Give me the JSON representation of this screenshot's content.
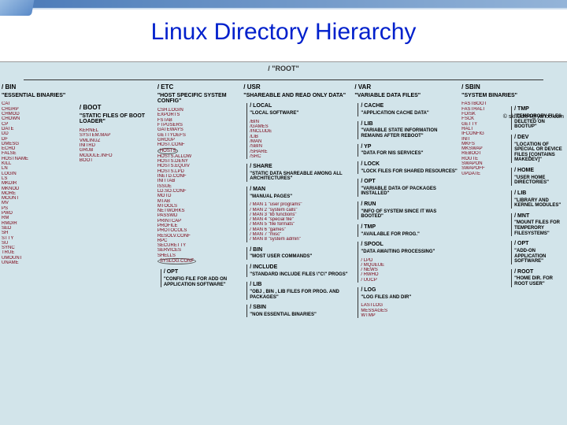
{
  "title": "Linux Directory Hierarchy",
  "attribution": "© skill2die4@yahoo.com",
  "root": "/  \"ROOT\"",
  "bin": {
    "name": "/ BIN",
    "desc": "\"ESSENTIAL BINARIES\"",
    "items": [
      "CAT",
      "CHGRP",
      "CHMOD",
      "CHOWN",
      "CP",
      "DATE",
      "DD",
      "DF",
      "DMESG",
      "ECHO",
      "FALSE",
      "HOSTNAME",
      "KILL",
      "LN",
      "LOGIN",
      "LS",
      "MKDIR",
      "MKNOD",
      "MORE",
      "MOUNT",
      "MV",
      "PS",
      "PWD",
      "RM",
      "RMDIR",
      "SED",
      "SH",
      "STTY",
      "SU",
      "SYNC",
      "TRUE",
      "UMOUNT",
      "UNAME"
    ]
  },
  "boot": {
    "name": "/ BOOT",
    "desc": "\"STATIC FILES OF BOOT LOADER\"",
    "items": [
      "KERNEL",
      "SYSTEM.MAP",
      "VMLINUZ",
      "INITRD",
      "GRUB",
      "MODULE.INFO",
      "BOOT"
    ]
  },
  "etc": {
    "name": "/ ETC",
    "desc": "\"HOST SPECIFIC SYSTEM CONFIG\"",
    "items": [
      "CSH.LOGIN",
      "EXPORTS",
      "FSTAB",
      "FTPUSERS",
      "GATEWAYS",
      "GETTYDEFS",
      "GROUP",
      "HOST.CONF",
      "HOSTS",
      "HOSTS.ALLOW",
      "HOSTS.DENY",
      "HOSTS.EQUIV",
      "HOSTS.LPD",
      "INETD.CONF",
      "INITTAB",
      "ISSUE",
      "LD.SO.CONF",
      "MOTD",
      "MTAB",
      "MTOOLS",
      "NETWORKS",
      "PASSWD",
      "PRINTCAP",
      "PROFILE",
      "PROTOCOLS",
      "RESOLV.CONF",
      "RPC",
      "SECURETTY",
      "SERVICES",
      "SHELLS",
      "SYSLOG.CONF"
    ],
    "hosts_circled": "HOSTS",
    "syslog_circled": "SYSLOG.CONF",
    "opt": {
      "name": "/ OPT",
      "desc": "\"CONFIG FILE FOR ADD ON APPLICATION SOFTWARE\""
    }
  },
  "usr": {
    "name": "/ USR",
    "desc": "\"SHAREABLE AND READ ONLY DATA\"",
    "local": {
      "name": "/ LOCAL",
      "desc": "\"LOCAL SOFTWARE\"",
      "items": [
        "/BIN",
        "/GAMES",
        "/INCLUDE",
        "/LIB",
        "/MAN",
        "/SBIN",
        "/SHARE",
        "/SRC"
      ]
    },
    "share": {
      "name": "/ SHARE",
      "desc": "\"STATIC DATA SHAREABLE AMONG ALL ARCHITECTURES\""
    },
    "man": {
      "name": "/ MAN",
      "desc": "\"MANUAL PAGES\"",
      "items": [
        "/ MAN 1 \"user programs\"",
        "/ MAN 2 \"system calls\"",
        "/ MAN 3 \"lib functions\"",
        "/ MAN 4 \"special file\"",
        "/ MAN 5 \"file formats\"",
        "/ MAN 6 \"games\"",
        "/ MAN 7 \"misc\"",
        "/ MAN 8 \"system admin\""
      ]
    },
    "usrbin": {
      "name": "/ BIN",
      "desc": "\"MOST USER COMMANDS\""
    },
    "include": {
      "name": "/ INCLUDE",
      "desc": "\"STANDARD INCLUDE FILES \\\"C\\\" PROGS\""
    },
    "usrlib": {
      "name": "/ LIB",
      "desc": "\"OBJ , BIN , LIB FILES FOR PROG. AND PACKAGES\""
    },
    "usrsbin": {
      "name": "/ SBIN",
      "desc": "\"NON ESSENTIAL BINARIES\""
    }
  },
  "var": {
    "name": "/ VAR",
    "desc": "\"VARIABLE DATA FILES\"",
    "cache": {
      "name": "/ CACHE",
      "desc": "\"APPLICATION CACHE DATA\""
    },
    "lib": {
      "name": "/ LIB",
      "desc": "\"VARIABLE STATE INFORMATION REMAINS AFTER REBOOT\""
    },
    "yp": {
      "name": "/ YP",
      "desc": "\"DATA FOR NIS SERVICES\""
    },
    "lock": {
      "name": "/ LOCK",
      "desc": "\"LOCK FILES FOR SHARED RESOURCES\""
    },
    "opt": {
      "name": "/ OPT",
      "desc": "\"VARIABLE DATA OF PACKAGES INSTALLED\""
    },
    "run": {
      "name": "/ RUN",
      "desc": "\"INFO OF SYSTEM SINCE IT WAS BOOTED\""
    },
    "tmp": {
      "name": "/ TMP",
      "desc": "\"AVAILABLE FOR PROG.\""
    },
    "spool": {
      "name": "/ SPOOL",
      "desc": "\"DATA AWAITING PROCESSING\"",
      "items": [
        "/ LPD",
        "/ MQUEUE",
        "/ NEWS",
        "/ RWHO",
        "/ UUCP"
      ]
    },
    "log": {
      "name": "/ LOG",
      "desc": "\"LOG FILES AND DIR\"",
      "items": [
        "LASTLOG",
        "MESSAGES",
        "WTMP"
      ]
    }
  },
  "sbin": {
    "name": "/ SBIN",
    "desc": "\"SYSTEM BINARIES\"",
    "items": [
      "FASTBOOT",
      "FASTHALT",
      "FDISK",
      "FSCK",
      "GETTY",
      "HALT",
      "IFCONFIG",
      "INIT",
      "MKFS",
      "MKSWAP",
      "REBOOT",
      "ROUTE",
      "SWAPON",
      "SWAPOFF",
      "UPDATE"
    ],
    "tmp": {
      "name": "/ TMP",
      "desc": "\"TEMPORORY FILES DELETED ON BOOTUP\""
    },
    "dev": {
      "name": "/ DEV",
      "desc": "\"LOCATION OF SPECIAL OR DEVICE FILES [CONTAINS MAKEDEV]\""
    },
    "home": {
      "name": "/ HOME",
      "desc": "\"USER HOME DIRECTORIES\""
    },
    "lib": {
      "name": "/ LIB",
      "desc": "\"LIBRARY AND KERNEL MODULES\""
    },
    "mnt": {
      "name": "/ MNT",
      "desc": "\"MOUNT FILES FOR TEMPERORY FILESYSTEMS\""
    },
    "opt": {
      "name": "/ OPT",
      "desc": "\"ADD-ON APPLICATION SOFTWARE\""
    },
    "root": {
      "name": "/ ROOT",
      "desc": "\"HOME DIR. FOR ROOT USER\""
    }
  }
}
